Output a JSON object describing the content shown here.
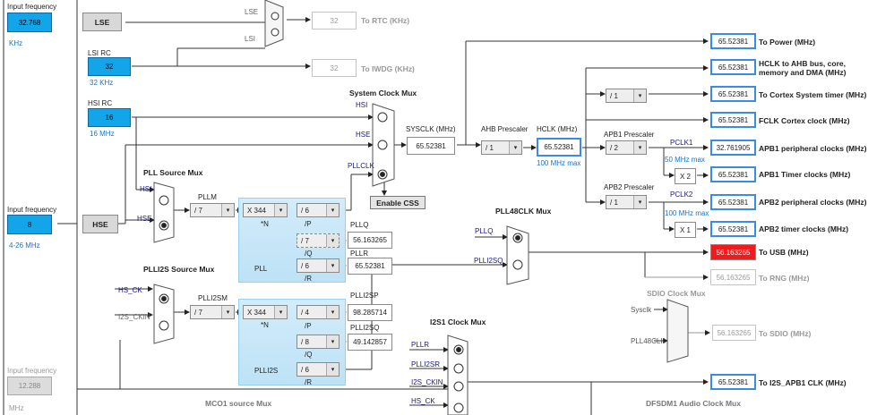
{
  "inputs": {
    "lse": {
      "freq_label": "Input frequency",
      "value": "32.768",
      "unit": "KHz",
      "name": "LSE"
    },
    "hse": {
      "freq_label": "Input frequency",
      "value": "8",
      "range": "4-26 MHz",
      "name": "HSE"
    },
    "i2s_ext": {
      "freq_label": "Input frequency",
      "value": "12.288",
      "unit": "MHz"
    },
    "lsi": {
      "name": "LSI RC",
      "value": "32",
      "unit": "32 KHz"
    },
    "hsi": {
      "name": "HSI RC",
      "value": "16",
      "unit": "16 MHz"
    }
  },
  "rtc": {
    "mux_lse": "LSE",
    "mux_lsi": "LSI",
    "value": "32",
    "label": "To RTC (KHz)"
  },
  "iwdg": {
    "value": "32",
    "label": "To IWDG (KHz)"
  },
  "sysmux": {
    "title": "System Clock Mux",
    "hsi": "HSI",
    "hse": "HSE",
    "pllclk": "PLLCLK",
    "css": "Enable CSS"
  },
  "sysclk": {
    "label": "SYSCLK (MHz)",
    "value": "65.52381"
  },
  "ahb": {
    "label": "AHB Prescaler",
    "value": "/ 1"
  },
  "hclk": {
    "label": "HCLK (MHz)",
    "value": "65.52381",
    "note": "100 MHz max"
  },
  "apb1": {
    "label": "APB1 Prescaler",
    "value": "/ 2",
    "pclk": "PCLK1",
    "note": "50 MHz max",
    "x": "X 2"
  },
  "apb2": {
    "label": "APB2 Prescaler",
    "value": "/ 1",
    "pclk": "PCLK2",
    "note": "100 MHz max",
    "x": "X 1"
  },
  "cortex_div": "/ 1",
  "outputs": [
    {
      "value": "65.52381",
      "label": "To Power (MHz)"
    },
    {
      "value": "65.52381",
      "label": "HCLK to AHB bus, core,",
      "label2": "memory and DMA (MHz)"
    },
    {
      "value": "65.52381",
      "label": "To Cortex System timer (MHz)"
    },
    {
      "value": "65.52381",
      "label": "FCLK Cortex clock (MHz)"
    },
    {
      "value": "32.761905",
      "label": "APB1 peripheral clocks (MHz)"
    },
    {
      "value": "65.52381",
      "label": "APB1 Timer clocks (MHz)"
    },
    {
      "value": "65.52381",
      "label": "APB2 peripheral clocks (MHz)"
    },
    {
      "value": "65.52381",
      "label": "APB2 timer clocks (MHz)"
    },
    {
      "value": "56.163265",
      "label": "To USB (MHz)"
    },
    {
      "value": "56.163265",
      "label": "To RNG (MHz)"
    },
    {
      "value": "56.163265",
      "label": "To SDIO (MHz)"
    },
    {
      "value": "65.52381",
      "label": "To I2S_APB1 CLK (MHz)"
    }
  ],
  "pllsrc": {
    "title": "PLL Source Mux",
    "hsi": "HSI",
    "hse": "HSE"
  },
  "pll": {
    "m_label": "PLLM",
    "m": "/ 7",
    "n": "X 344",
    "n_lbl": "*N",
    "p": "/ 6",
    "p_lbl": "/P",
    "q": "/ 7",
    "q_lbl": "/Q",
    "r": "/ 6",
    "r_lbl": "/R",
    "name": "PLL",
    "pllq_label": "PLLQ",
    "pllq": "56.163265",
    "pllr_label": "PLLR",
    "pllr": "65.52381"
  },
  "pll48": {
    "title": "PLL48CLK Mux",
    "a": "PLLQ",
    "b": "PLLI2SQ"
  },
  "plli2ssrc": {
    "title": "PLLI2S Source Mux",
    "a": "HS_CK",
    "b": "I2S_CKIN",
    "m_label": "PLLI2SM",
    "m": "/ 7"
  },
  "plli2s": {
    "n": "X 344",
    "n_lbl": "*N",
    "p": "/ 4",
    "p_lbl": "/P",
    "q": "/ 8",
    "q_lbl": "/Q",
    "r": "/ 6",
    "r_lbl": "/R",
    "name": "PLLI2S",
    "sp_label": "PLLI2SP",
    "sp": "98.285714",
    "sq_label": "PLLI2SQ",
    "sq": "49.142857"
  },
  "i2s1": {
    "title": "I2S1 Clock Mux",
    "a": "PLLR",
    "b": "PLLI2SR",
    "c": "I2S_CKIN",
    "d": "HS_CK"
  },
  "sdio": {
    "title": "SDIO Clock Mux",
    "a": "Sysclk",
    "b": "PLL48CLK"
  },
  "mco1": "MCO1 source Mux",
  "dfsdm": "DFSDM1 Audio Clock Mux"
}
